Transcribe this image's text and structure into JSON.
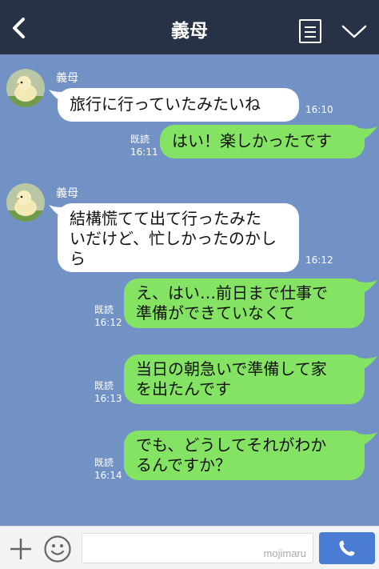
{
  "header": {
    "title": "義母",
    "back_icon": "chevron-left-icon",
    "menu_icon": "notes-icon",
    "expand_icon": "chevron-down-icon"
  },
  "messages": [
    {
      "sender": "義母",
      "side": "left",
      "text": "旅行に行っていたみたいね",
      "time": "16:10"
    },
    {
      "side": "right",
      "text": "はい！楽しかったです",
      "read": "既読",
      "time": "16:11"
    },
    {
      "sender": "義母",
      "side": "left",
      "lines": [
        "結構慌てて出て行ったみた",
        "いだけど、忙しかったのかし",
        "ら"
      ],
      "time": "16:12"
    },
    {
      "side": "right",
      "lines": [
        "え、はい…前日まで仕事で",
        "準備ができていなくて"
      ],
      "read": "既読",
      "time": "16:12"
    },
    {
      "side": "right",
      "lines": [
        "当日の朝急いで準備して家",
        "を出たんです"
      ],
      "read": "既読",
      "time": "16:13"
    },
    {
      "side": "right",
      "lines": [
        "でも、どうしてそれがわか",
        "るんですか？"
      ],
      "read": "既読",
      "time": "16:14"
    }
  ],
  "footer": {
    "watermark": "mojimaru",
    "plus_icon": "plus-icon",
    "emoji_icon": "smiley-icon",
    "call_icon": "phone-icon"
  },
  "colors": {
    "header_bg": "#273246",
    "chat_bg": "#7291c5",
    "bubble_incoming": "#ffffff",
    "bubble_outgoing": "#84e363",
    "call_button": "#4a7cd4"
  }
}
